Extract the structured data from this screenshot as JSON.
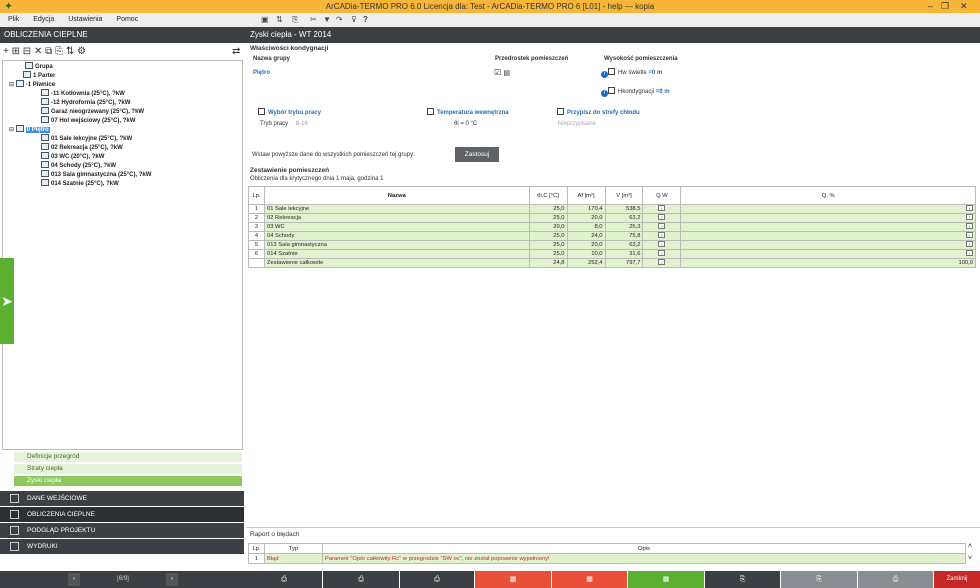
{
  "app": {
    "title": "ArCADia-TERMO PRO 6.0 Licencja dla: Test - ArCADia-TERMO PRO 6 [L01] - help — kopia"
  },
  "menu": [
    "Plik",
    "Edycja",
    "Ustawienia",
    "Pomoc"
  ],
  "left": {
    "header": "OBLICZENIA CIEPLNE",
    "tree": [
      {
        "label": "Grupa",
        "level": 0,
        "selected": false
      },
      {
        "label": "1 Parter",
        "level": 1,
        "selected": false
      },
      {
        "label": "-1 Piwnice",
        "level": 1,
        "selected": false
      },
      {
        "label": "-11 Kotłownia (25°C), ?kW",
        "level": 2,
        "selected": false
      },
      {
        "label": "-12 Hydrofornia (25°C), ?kW",
        "level": 2,
        "selected": false
      },
      {
        "label": "Garaż nieogrzewany (25°C), ?kW",
        "level": 2,
        "selected": false
      },
      {
        "label": "07 Hol wejściowy (25°C), ?kW",
        "level": 2,
        "selected": false
      },
      {
        "label": "0 Piętro",
        "level": 1,
        "selected": true
      },
      {
        "label": "01 Sale lekcyjne (25°C), ?kW",
        "level": 2,
        "selected": false
      },
      {
        "label": "02 Rekreacja (25°C), ?kW",
        "level": 2,
        "selected": false
      },
      {
        "label": "03 WC (20°C), ?kW",
        "level": 2,
        "selected": false
      },
      {
        "label": "04 Schody (25°C), ?kW",
        "level": 2,
        "selected": false
      },
      {
        "label": "013 Sala gimnastyczna (25°C), ?kW",
        "level": 2,
        "selected": false
      },
      {
        "label": "014 Szatnie (25°C), ?kW",
        "level": 2,
        "selected": false
      }
    ],
    "subitems": [
      "Definicje przegród",
      "Straty ciepła",
      "Zyski ciepła"
    ],
    "nav": [
      "DANE WEJŚCIOWE",
      "OBLICZENIA CIEPLNE",
      "PODGLĄD PROJEKTU",
      "WYDRUKI"
    ],
    "pager": "[6/9]"
  },
  "right": {
    "header": "Zyski ciepła - WT 2014",
    "props_title": "Właściwości kondygnacji",
    "group_name_label": "Nazwa grupy",
    "group_name": "Piętro",
    "przedrostek_label": "Przedrostek pomieszczeń",
    "height_label": "Wysokość pomieszczenia",
    "h_swiatle": "Hw świetle",
    "h_swiatle_val": "=0  m",
    "h_kond": "Hkondygnacji",
    "h_kond_val": "=0  m",
    "tryb_label": "Wybór trybu pracy",
    "tryb_pracy": "Tryb pracy",
    "tryb_val": "8-16",
    "temp_label": "Temperatura wewnętrzna",
    "temp_val": "θi =  0  °C",
    "strefa_label": "Przypisz do strefy chłodu",
    "strefa_val": "Nieprzypisane",
    "apply_text": "Wstaw powyższe dane do wszystkich pomieszczeń tej grupy:",
    "apply_btn": "Zastosuj",
    "zest_title": "Zestawienie pomieszczeń",
    "zest_sub": "Obliczenia dla krytycznego dnia 1 maja, godzina 1",
    "cols": [
      "Lp.",
      "Nazwa",
      "θi,C [°C]",
      "Af [m²]",
      "V [m³]",
      "Q W",
      "Q, %"
    ],
    "rows": [
      {
        "lp": "1",
        "name": "01 Sale lekcyjne",
        "t": "25,0",
        "af": "170,4",
        "v": "538,5",
        "q": "",
        "qp": ""
      },
      {
        "lp": "2",
        "name": "02 Rekreacja",
        "t": "25,0",
        "af": "20,0",
        "v": "63,2",
        "q": "",
        "qp": ""
      },
      {
        "lp": "3",
        "name": "03 WC",
        "t": "20,0",
        "af": "8,0",
        "v": "25,3",
        "q": "",
        "qp": ""
      },
      {
        "lp": "4",
        "name": "04 Schody",
        "t": "25,0",
        "af": "24,0",
        "v": "75,8",
        "q": "",
        "qp": ""
      },
      {
        "lp": "5",
        "name": "013 Sala gimnastyczna",
        "t": "25,0",
        "af": "20,0",
        "v": "63,2",
        "q": "",
        "qp": ""
      },
      {
        "lp": "6",
        "name": "014 Szatnie",
        "t": "25,0",
        "af": "10,0",
        "v": "31,6",
        "q": "",
        "qp": ""
      },
      {
        "lp": "",
        "name": "Zestawienie całkowite",
        "t": "24,8",
        "af": "252,4",
        "v": "797,7",
        "q": "",
        "qp": "100,0"
      }
    ],
    "err_title": "Raport o błędach",
    "err_cols": [
      "Lp.",
      "Typ",
      "Opis"
    ],
    "err_rows": [
      {
        "lp": "1",
        "typ": "Błąd",
        "opis": "Parametr \"Opór całkowity Rc\" w przegrodzie \"SW oc\", nie został poprawnie wypełniony!"
      }
    ],
    "close_btn": "Zamknij"
  },
  "colors": {
    "title_bg": "#f7b638",
    "dark": "#3c3f44",
    "green": "#5cb030",
    "row_green": "#e2f2cf",
    "red": "#e8503a",
    "red_btn": "#c62828"
  }
}
